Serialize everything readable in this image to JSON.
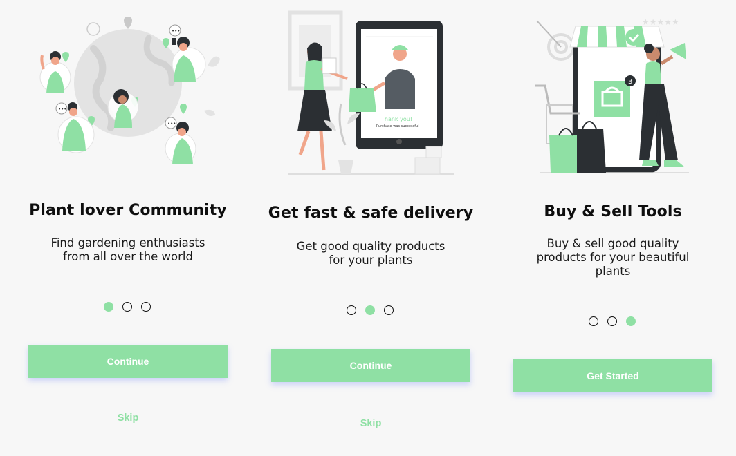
{
  "screens": [
    {
      "title": "Plant lover Community",
      "desc_lines": [
        "Find gardening enthusiasts",
        "from all over the world"
      ],
      "dots": [
        true,
        false,
        false
      ],
      "button_label": "Continue",
      "skip_label": "Skip"
    },
    {
      "title": "Get fast & safe delivery",
      "desc_lines": [
        "Get good quality products",
        "for your plants"
      ],
      "dots": [
        false,
        true,
        false
      ],
      "button_label": "Continue",
      "skip_label": "Skip",
      "tablet_text": {
        "thank_you": "Thank you!",
        "purchase": "Purchase was successful"
      }
    },
    {
      "title": "Buy & Sell Tools",
      "desc_lines": [
        "Buy & sell good quality",
        "products for your beautiful",
        "plants"
      ],
      "dots": [
        false,
        false,
        true
      ],
      "button_label": "Get Started",
      "cart_badge": "3"
    }
  ],
  "colors": {
    "accent": "#8fe0a4",
    "dark": "#2b2f33",
    "background": "#f7f7f7"
  }
}
